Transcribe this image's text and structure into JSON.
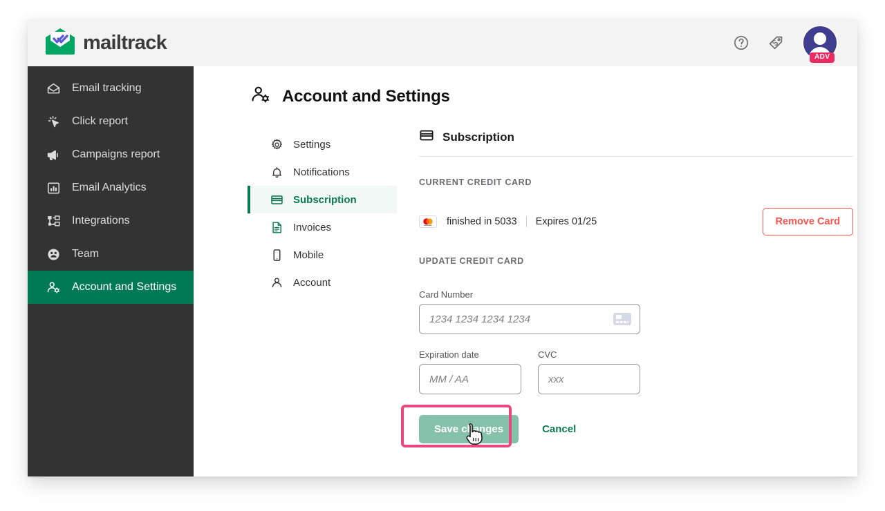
{
  "brand": {
    "name": "mailtrack",
    "logo_icon": "mailtrack-envelope-logo",
    "green": "#00a663"
  },
  "topbar": {
    "help_icon": "help-circle-icon",
    "tag_icon": "tag-icon",
    "avatar_icon": "user-avatar",
    "avatar_badge": "ADV",
    "badge_color": "#ec2b63",
    "avatar_color": "#3f3d8e",
    "background": "#f3f3f3"
  },
  "sidebar": {
    "background": "#333333",
    "active_color": "#007a55",
    "items": [
      {
        "label": "Email tracking",
        "icon": "open-envelope-icon",
        "active": false
      },
      {
        "label": "Click report",
        "icon": "click-cursor-icon",
        "active": false
      },
      {
        "label": "Campaigns report",
        "icon": "megaphone-icon",
        "active": false
      },
      {
        "label": "Email Analytics",
        "icon": "bar-chart-icon",
        "active": false
      },
      {
        "label": "Integrations",
        "icon": "sitemap-icon",
        "active": false
      },
      {
        "label": "Team",
        "icon": "people-circle-icon",
        "active": false
      },
      {
        "label": "Account and Settings",
        "icon": "user-gear-icon",
        "active": true
      }
    ]
  },
  "page": {
    "title": "Account and Settings",
    "title_icon": "user-gear-icon"
  },
  "settings_nav": {
    "active_color": "#0b7a52",
    "items": [
      {
        "label": "Settings",
        "icon": "gear-icon",
        "active": false
      },
      {
        "label": "Notifications",
        "icon": "bell-icon",
        "active": false
      },
      {
        "label": "Subscription",
        "icon": "credit-card-icon",
        "active": true
      },
      {
        "label": "Invoices",
        "icon": "document-icon",
        "active": false
      },
      {
        "label": "Mobile",
        "icon": "mobile-phone-icon",
        "active": false
      },
      {
        "label": "Account",
        "icon": "person-icon",
        "active": false
      }
    ]
  },
  "panel": {
    "title": "Subscription",
    "title_icon": "credit-card-icon",
    "current_card": {
      "section_label": "CURRENT CREDIT CARD",
      "brand_icon": "mastercard-icon",
      "masked_text": "finished in 5033",
      "expires_text": "Expires 01/25",
      "remove_button": "Remove Card",
      "remove_button_color": "#fa5450"
    },
    "update_card": {
      "section_label": "UPDATE CREDIT CARD",
      "card_number": {
        "label": "Card Number",
        "value": "",
        "placeholder": "1234 1234 1234 1234",
        "trailing_icon": "credit-card-placeholder-icon"
      },
      "expiration": {
        "label": "Expiration date",
        "value": "",
        "placeholder": "MM / AA"
      },
      "cvc": {
        "label": "CVC",
        "value": "",
        "placeholder": "xxx"
      }
    },
    "actions": {
      "save_label": "Save changes",
      "save_color": "#85c2a9",
      "cancel_label": "Cancel",
      "cancel_color": "#0b7a52",
      "highlight_color": "#e8477f"
    }
  }
}
